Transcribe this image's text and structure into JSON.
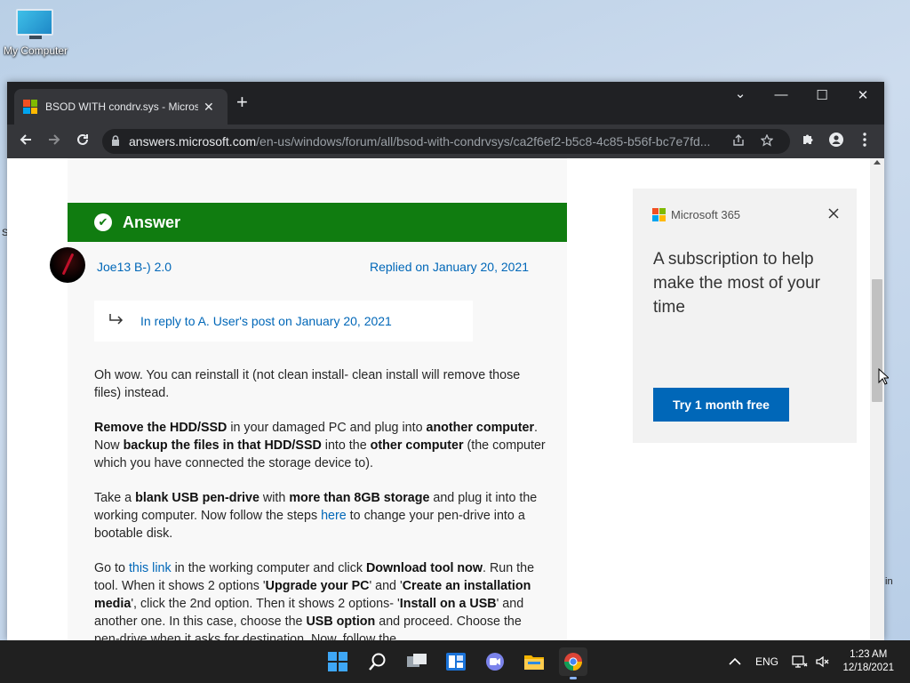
{
  "desktop": {
    "icon_label": "My Computer",
    "edge_text_left": "S",
    "edge_text_right": "in"
  },
  "browser": {
    "tab": {
      "title": "BSOD WITH condrv.sys - Microsoft Community",
      "close_symbol": "✕"
    },
    "new_tab_symbol": "+",
    "window_controls": {
      "dropdown": "⌄",
      "minimize": "—",
      "maximize": "☐",
      "close": "✕"
    },
    "address": {
      "host": "answers.microsoft.com",
      "path": "/en-us/windows/forum/all/bsod-with-condrvsys/ca2f6ef2-b5c8-4c85-b56f-bc7e7fd..."
    }
  },
  "page": {
    "answer_label": "Answer",
    "author": "Joe13 B-) 2.0",
    "replied": "Replied on January 20, 2021",
    "in_reply": "In reply to A. User's post on January 20, 2021",
    "paragraphs": {
      "p1": "Oh wow. You can reinstall it (not clean install- clean install will remove those files) instead.",
      "p2": [
        {
          "t": "Remove the HDD/SSD",
          "b": true
        },
        {
          "t": " in your damaged PC and plug into ",
          "b": false
        },
        {
          "t": "another computer",
          "b": true
        },
        {
          "t": ". Now ",
          "b": false
        },
        {
          "t": "backup the files in that HDD/SSD",
          "b": true
        },
        {
          "t": " into the ",
          "b": false
        },
        {
          "t": "other computer",
          "b": true
        },
        {
          "t": " (the computer which you have connected the storage device to).",
          "b": false
        }
      ],
      "p3": [
        {
          "t": "Take a ",
          "b": false
        },
        {
          "t": "blank USB pen-drive",
          "b": true
        },
        {
          "t": " with ",
          "b": false
        },
        {
          "t": "more than 8GB storage",
          "b": true
        },
        {
          "t": " and plug it into the working computer. Now follow the steps ",
          "b": false
        },
        {
          "t": "here",
          "link": true
        },
        {
          "t": " to change your pen-drive into a bootable disk.",
          "b": false
        }
      ],
      "p4": [
        {
          "t": "Go to ",
          "b": false
        },
        {
          "t": "this link",
          "link": true
        },
        {
          "t": " in the working computer and click ",
          "b": false
        },
        {
          "t": "Download tool now",
          "b": true
        },
        {
          "t": ". Run the tool. When it shows 2 options '",
          "b": false
        },
        {
          "t": "Upgrade your PC",
          "b": true
        },
        {
          "t": "' and '",
          "b": false
        },
        {
          "t": "Create an installation media",
          "b": true
        },
        {
          "t": "', click the 2nd option. Then it shows 2 options- '",
          "b": false
        },
        {
          "t": "Install on a USB",
          "b": true
        },
        {
          "t": "' and another one. In this case, choose the ",
          "b": false
        },
        {
          "t": "USB option",
          "b": true
        },
        {
          "t": " and proceed. Choose the pen-drive when it asks for destination. Now, follow the",
          "b": false
        }
      ]
    }
  },
  "ad": {
    "brand": "Microsoft 365",
    "headline": "A subscription to help make the most of your time",
    "cta": "Try 1 month free"
  },
  "taskbar": {
    "language": "ENG",
    "time": "1:23 AM",
    "date": "12/18/2021"
  }
}
